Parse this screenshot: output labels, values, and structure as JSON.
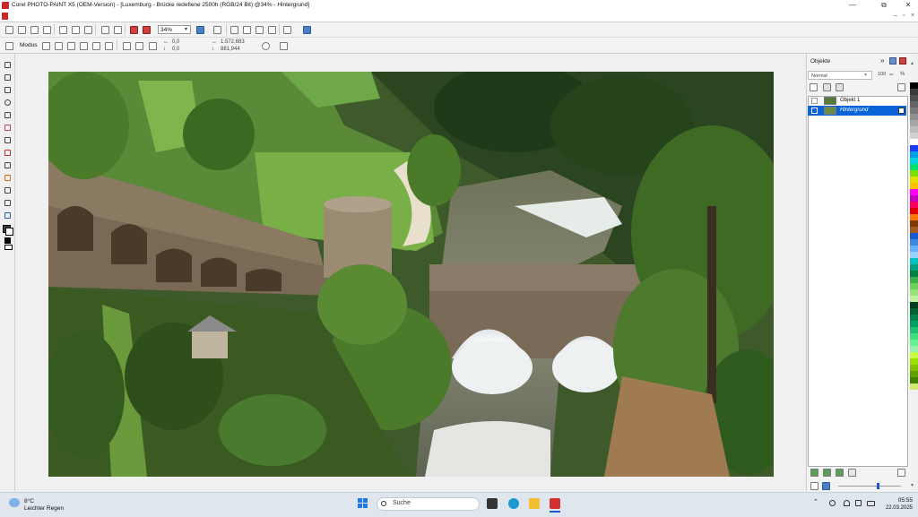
{
  "window": {
    "title": "Corel PHOTO-PAINT X5 (OEM-Version) - [Luxemburg - Brücke redefiene 2500h (RGB/24 Bit) @34% - Hintergrund]",
    "minimize_glyph": "—",
    "maximize_glyph": "⧉",
    "close_glyph": "✕"
  },
  "document_controls": {
    "minimize_glyph": "–",
    "restore_glyph": "▫",
    "close_glyph": "×"
  },
  "toolbar": {
    "zoom": "34%",
    "modus_label": "Modus",
    "pos_x": "0,0",
    "pos_y": "0,0",
    "width_val": "1.572,683",
    "height_val": "881,944"
  },
  "docker": {
    "title": "Objekte",
    "blend_mode": "Normal",
    "opacity": "100",
    "opacity_unit": "%",
    "objects": [
      {
        "label": "Objekt 1",
        "selected": false
      },
      {
        "label": "Hintergrund",
        "selected": true
      }
    ]
  },
  "palette": [
    "#000000",
    "#3a3a3a",
    "#4f4f4f",
    "#656565",
    "#7a7a7a",
    "#909090",
    "#a6a6a6",
    "#bcbcbc",
    "#d2d2d2",
    "#ffffff",
    "#1a3cff",
    "#00a0e8",
    "#00d2e0",
    "#00e070",
    "#7ae000",
    "#e0e000",
    "#ffc000",
    "#ff00ff",
    "#c000c0",
    "#ff0060",
    "#e00000",
    "#ff7a00",
    "#7a3a00",
    "#a05a20",
    "#1a5ad0",
    "#3a8ae0",
    "#6ab0ff",
    "#9acfff",
    "#00c0c0",
    "#00a080",
    "#008040",
    "#3ab04a",
    "#6ad05a",
    "#9ae07a",
    "#c0f0a0",
    "#004020",
    "#006030",
    "#008050",
    "#00a060",
    "#20c070",
    "#40e080",
    "#6af090",
    "#9af0b0",
    "#c8ff40",
    "#a0e000",
    "#80c000",
    "#60a000",
    "#408000",
    "#cfe870"
  ],
  "taskbar": {
    "temperature": "8°C",
    "weather": "Leichter Regen",
    "search_placeholder": "Suche",
    "time": "05:55",
    "date": "22.03.2025"
  }
}
